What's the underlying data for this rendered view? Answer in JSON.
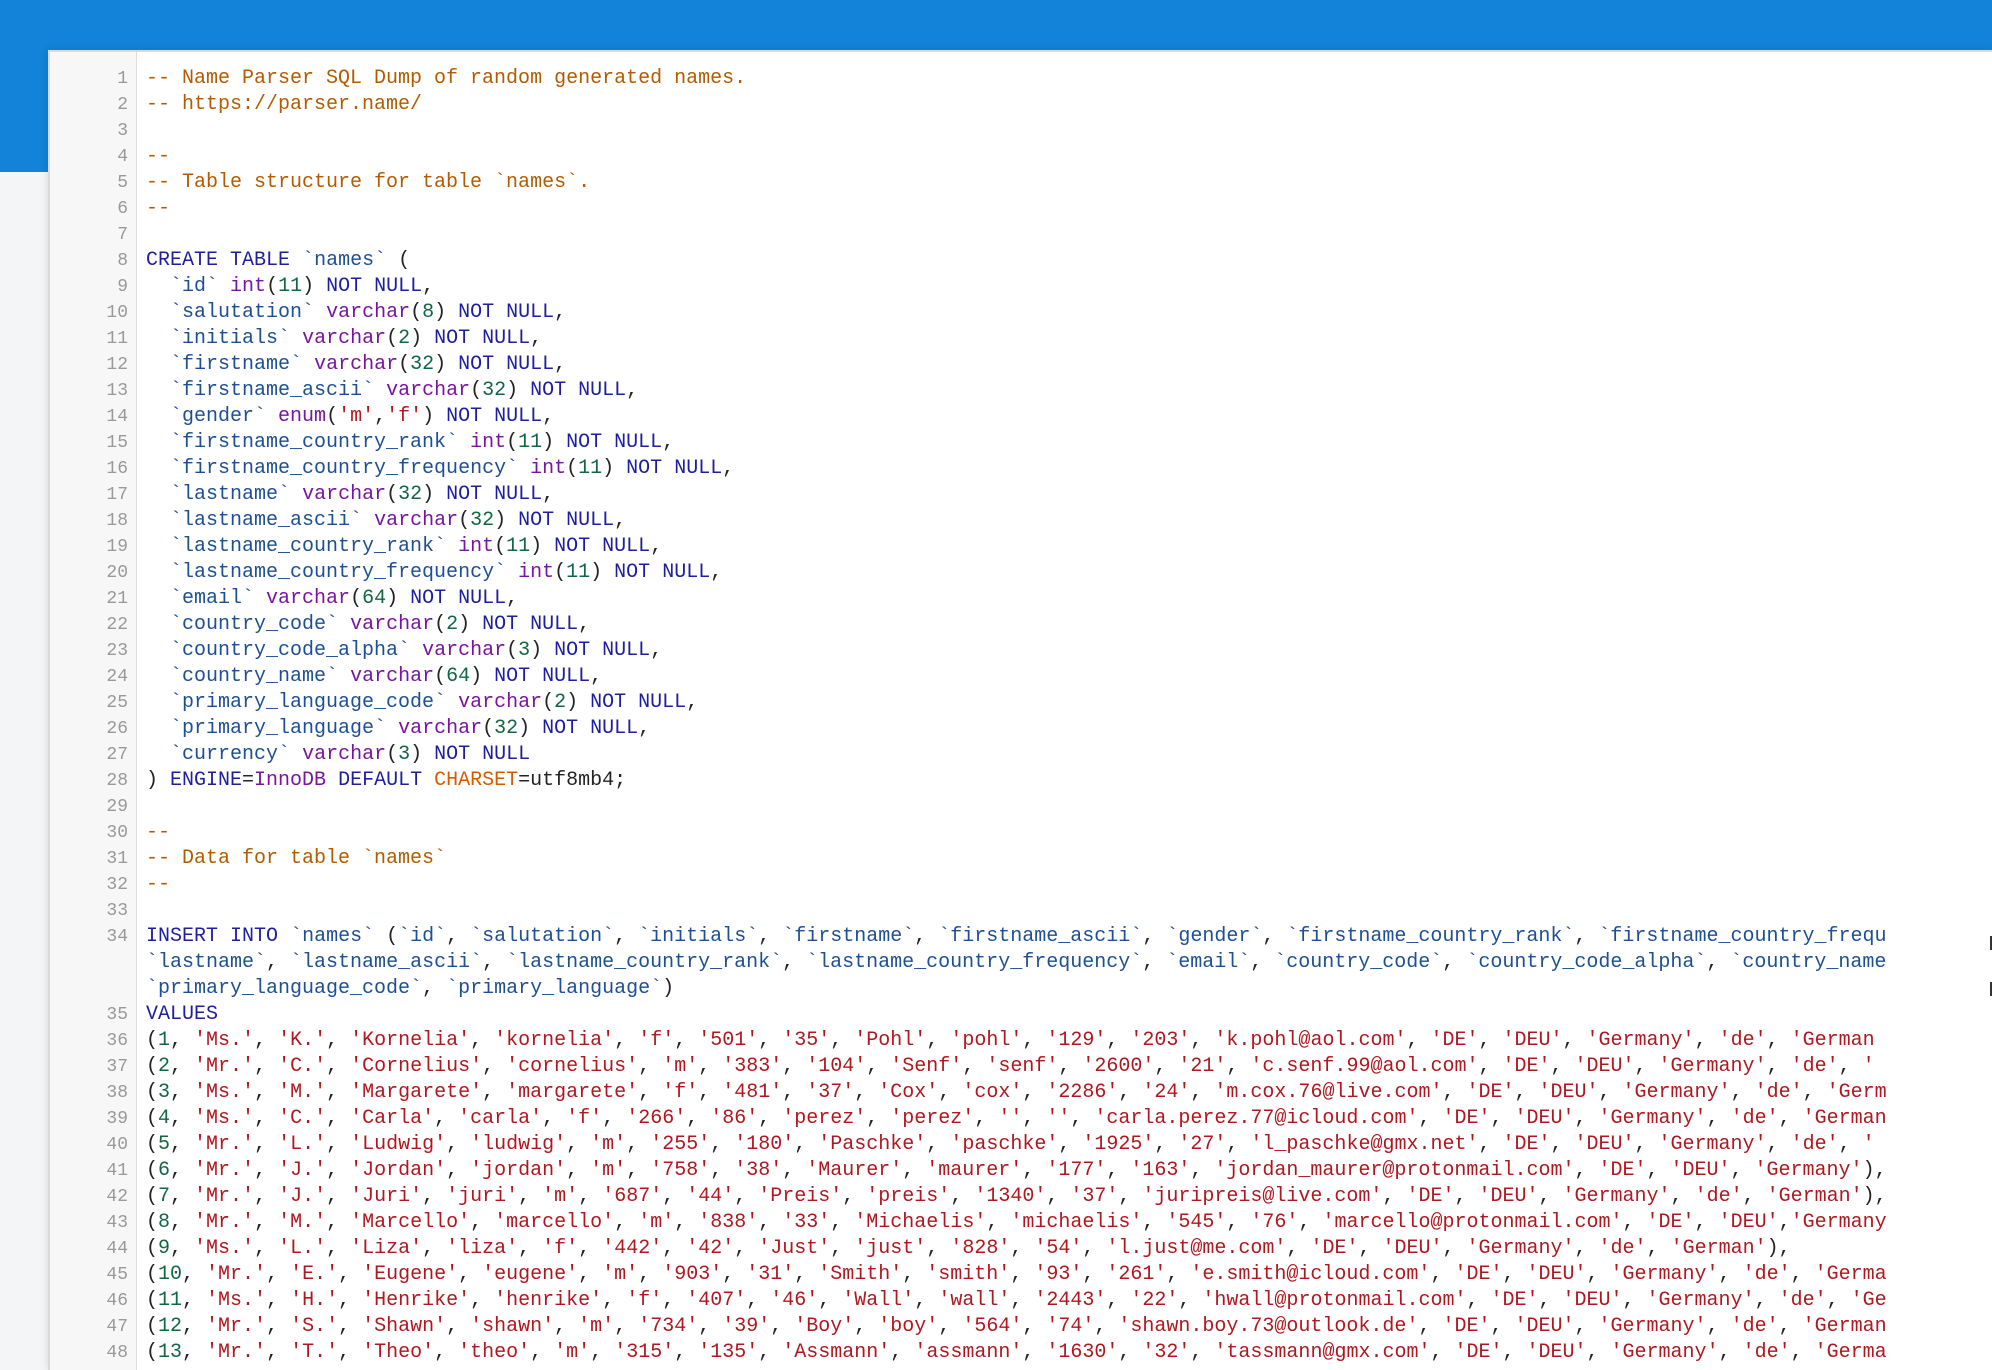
{
  "colors": {
    "topbar": "#1283d8",
    "comment": "#b35b00",
    "keyword": "#7a14a0",
    "identifier": "#1d4f96",
    "number": "#116644",
    "string": "#b0171f"
  },
  "editor": {
    "lines": [
      {
        "n": "1",
        "t": "-- Name Parser SQL Dump of random generated names."
      },
      {
        "n": "2",
        "t": "-- https://parser.name/"
      },
      {
        "n": "3",
        "t": ""
      },
      {
        "n": "4",
        "t": "--"
      },
      {
        "n": "5",
        "t": "-- Table structure for table `names`."
      },
      {
        "n": "6",
        "t": "--"
      },
      {
        "n": "7",
        "t": ""
      },
      {
        "n": "8",
        "t": "CREATE TABLE `names` ("
      },
      {
        "n": "9",
        "t": "  `id` int(11) NOT NULL,"
      },
      {
        "n": "10",
        "t": "  `salutation` varchar(8) NOT NULL,"
      },
      {
        "n": "11",
        "t": "  `initials` varchar(2) NOT NULL,"
      },
      {
        "n": "12",
        "t": "  `firstname` varchar(32) NOT NULL,"
      },
      {
        "n": "13",
        "t": "  `firstname_ascii` varchar(32) NOT NULL,"
      },
      {
        "n": "14",
        "t": "  `gender` enum('m','f') NOT NULL,"
      },
      {
        "n": "15",
        "t": "  `firstname_country_rank` int(11) NOT NULL,"
      },
      {
        "n": "16",
        "t": "  `firstname_country_frequency` int(11) NOT NULL,"
      },
      {
        "n": "17",
        "t": "  `lastname` varchar(32) NOT NULL,"
      },
      {
        "n": "18",
        "t": "  `lastname_ascii` varchar(32) NOT NULL,"
      },
      {
        "n": "19",
        "t": "  `lastname_country_rank` int(11) NOT NULL,"
      },
      {
        "n": "20",
        "t": "  `lastname_country_frequency` int(11) NOT NULL,"
      },
      {
        "n": "21",
        "t": "  `email` varchar(64) NOT NULL,"
      },
      {
        "n": "22",
        "t": "  `country_code` varchar(2) NOT NULL,"
      },
      {
        "n": "23",
        "t": "  `country_code_alpha` varchar(3) NOT NULL,"
      },
      {
        "n": "24",
        "t": "  `country_name` varchar(64) NOT NULL,"
      },
      {
        "n": "25",
        "t": "  `primary_language_code` varchar(2) NOT NULL,"
      },
      {
        "n": "26",
        "t": "  `primary_language` varchar(32) NOT NULL,"
      },
      {
        "n": "27",
        "t": "  `currency` varchar(3) NOT NULL"
      },
      {
        "n": "28",
        "t": ") ENGINE=InnoDB DEFAULT CHARSET=utf8mb4;"
      },
      {
        "n": "29",
        "t": ""
      },
      {
        "n": "30",
        "t": "--"
      },
      {
        "n": "31",
        "t": "-- Data for table `names`"
      },
      {
        "n": "32",
        "t": "--"
      },
      {
        "n": "33",
        "t": ""
      },
      {
        "n": "34",
        "t": "INSERT INTO `names` (`id`, `salutation`, `initials`, `firstname`, `firstname_ascii`, `gender`, `firstname_country_rank`, `firstname_country_frequ\n`lastname`, `lastname_ascii`, `lastname_country_rank`, `lastname_country_frequency`, `email`, `country_code`, `country_code_alpha`, `country_name\n`primary_language_code`, `primary_language`)"
      },
      {
        "n": "35",
        "t": "VALUES"
      },
      {
        "n": "36",
        "t": "(1, 'Ms.', 'K.', 'Kornelia', 'kornelia', 'f', '501', '35', 'Pohl', 'pohl', '129', '203', 'k.pohl@aol.com', 'DE', 'DEU', 'Germany', 'de', 'German"
      },
      {
        "n": "37",
        "t": "(2, 'Mr.', 'C.', 'Cornelius', 'cornelius', 'm', '383', '104', 'Senf', 'senf', '2600', '21', 'c.senf.99@aol.com', 'DE', 'DEU', 'Germany', 'de', '"
      },
      {
        "n": "38",
        "t": "(3, 'Ms.', 'M.', 'Margarete', 'margarete', 'f', '481', '37', 'Cox', 'cox', '2286', '24', 'm.cox.76@live.com', 'DE', 'DEU', 'Germany', 'de', 'Germ"
      },
      {
        "n": "39",
        "t": "(4, 'Ms.', 'C.', 'Carla', 'carla', 'f', '266', '86', 'perez', 'perez', '', '', 'carla.perez.77@icloud.com', 'DE', 'DEU', 'Germany', 'de', 'German"
      },
      {
        "n": "40",
        "t": "(5, 'Mr.', 'L.', 'Ludwig', 'ludwig', 'm', '255', '180', 'Paschke', 'paschke', '1925', '27', 'l_paschke@gmx.net', 'DE', 'DEU', 'Germany', 'de', '"
      },
      {
        "n": "41",
        "t": "(6, 'Mr.', 'J.', 'Jordan', 'jordan', 'm', '758', '38', 'Maurer', 'maurer', '177', '163', 'jordan_maurer@protonmail.com', 'DE', 'DEU', 'Germany'),"
      },
      {
        "n": "42",
        "t": "(7, 'Mr.', 'J.', 'Juri', 'juri', 'm', '687', '44', 'Preis', 'preis', '1340', '37', 'juripreis@live.com', 'DE', 'DEU', 'Germany', 'de', 'German'),"
      },
      {
        "n": "43",
        "t": "(8, 'Mr.', 'M.', 'Marcello', 'marcello', 'm', '838', '33', 'Michaelis', 'michaelis', '545', '76', 'marcello@protonmail.com', 'DE', 'DEU','Germany"
      },
      {
        "n": "44",
        "t": "(9, 'Ms.', 'L.', 'Liza', 'liza', 'f', '442', '42', 'Just', 'just', '828', '54', 'l.just@me.com', 'DE', 'DEU', 'Germany', 'de', 'German'),"
      },
      {
        "n": "45",
        "t": "(10, 'Mr.', 'E.', 'Eugene', 'eugene', 'm', '903', '31', 'Smith', 'smith', '93', '261', 'e.smith@icloud.com', 'DE', 'DEU', 'Germany', 'de', 'Germa"
      },
      {
        "n": "46",
        "t": "(11, 'Ms.', 'H.', 'Henrike', 'henrike', 'f', '407', '46', 'Wall', 'wall', '2443', '22', 'hwall@protonmail.com', 'DE', 'DEU', 'Germany', 'de', 'Ge"
      },
      {
        "n": "47",
        "t": "(12, 'Mr.', 'S.', 'Shawn', 'shawn', 'm', '734', '39', 'Boy', 'boy', '564', '74', 'shawn.boy.73@outlook.de', 'DE', 'DEU', 'Germany', 'de', 'German"
      },
      {
        "n": "48",
        "t": "(13, 'Mr.', 'T.', 'Theo', 'theo', 'm', '315', '135', 'Assmann', 'assmann', '1630', '32', 'tassmann@gmx.com', 'DE', 'DEU', 'Germany', 'de', 'Germa"
      }
    ]
  }
}
